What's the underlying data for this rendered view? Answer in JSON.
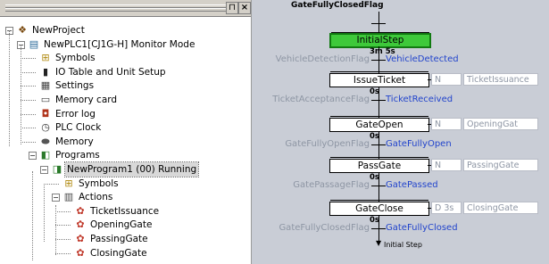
{
  "tree": {
    "pin_glyph": "⊓",
    "close_glyph": "×",
    "items": [
      {
        "label": "NewProject",
        "icon": "project-icon",
        "glyph": "❖"
      },
      {
        "label": "NewPLC1[CJ1G-H] Monitor Mode",
        "icon": "plc-icon",
        "glyph": "▤"
      },
      {
        "label": "Symbols",
        "icon": "symbols-icon",
        "glyph": "⊞"
      },
      {
        "label": "IO Table and Unit Setup",
        "icon": "io-table-icon",
        "glyph": "▮"
      },
      {
        "label": "Settings",
        "icon": "settings-icon",
        "glyph": "▦"
      },
      {
        "label": "Memory card",
        "icon": "memory-card-icon",
        "glyph": "▭"
      },
      {
        "label": "Error log",
        "icon": "error-log-icon",
        "glyph": "◘"
      },
      {
        "label": "PLC Clock",
        "icon": "plc-clock-icon",
        "glyph": "◷"
      },
      {
        "label": "Memory",
        "icon": "memory-icon",
        "glyph": "⬬"
      },
      {
        "label": "Programs",
        "icon": "programs-icon",
        "glyph": "◧"
      },
      {
        "label": "NewProgram1 (00) Running",
        "icon": "program-icon",
        "glyph": "◨"
      },
      {
        "label": "Symbols",
        "icon": "symbols-icon",
        "glyph": "⊞"
      },
      {
        "label": "Actions",
        "icon": "actions-icon",
        "glyph": "▥"
      },
      {
        "label": "TicketIssuance",
        "icon": "action-icon",
        "glyph": "✿"
      },
      {
        "label": "OpeningGate",
        "icon": "action-icon",
        "glyph": "✿"
      },
      {
        "label": "PassingGate",
        "icon": "action-icon",
        "glyph": "✿"
      },
      {
        "label": "ClosingGate",
        "icon": "action-icon",
        "glyph": "✿"
      }
    ],
    "expander_minus": "−"
  },
  "sfc": {
    "top_flag": "GateFullyClosedFlag",
    "steps": [
      {
        "name": "InitialStep",
        "time": "3m 5s",
        "active": true
      },
      {
        "name": "IssueTicket",
        "time": "0s",
        "qualifier": "N",
        "action": "TicketIssuance"
      },
      {
        "name": "GateOpen",
        "time": "0s",
        "qualifier": "N",
        "action": "OpeningGat"
      },
      {
        "name": "PassGate",
        "time": "0s",
        "qualifier": "N",
        "action": "PassingGate"
      },
      {
        "name": "GateClose",
        "time": "0s",
        "qualifier": "D 3s",
        "action": "ClosingGate"
      }
    ],
    "transitions": [
      {
        "input": "VehicleDetectionFlag",
        "output": "VehicleDetected"
      },
      {
        "input": "TicketAcceptanceFlag",
        "output": "TicketReceived"
      },
      {
        "input": "GateFullyOpenFlag",
        "output": "GateFullyOpen"
      },
      {
        "input": "GatePassageFlag",
        "output": "GatePassed"
      },
      {
        "input": "GateFullyClosedFlag",
        "output": "GateFullyClosed"
      }
    ],
    "jump_label": "Initial Step",
    "colors": {
      "background": "#c9cdd6",
      "active_step": "#3ec93a",
      "flag_out": "#2244cc",
      "flag_in": "#8e96a4"
    }
  }
}
